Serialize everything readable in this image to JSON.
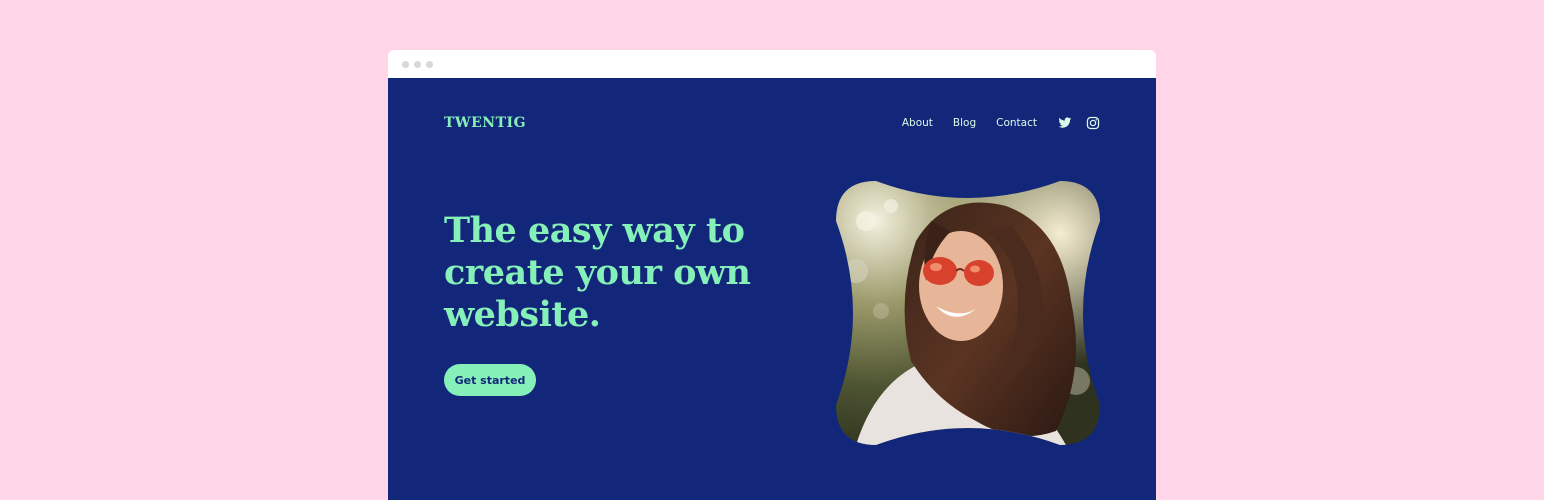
{
  "site": {
    "logo": "TWENTIG",
    "nav": {
      "items": [
        "About",
        "Blog",
        "Contact"
      ],
      "social": [
        "twitter-icon",
        "instagram-icon"
      ]
    },
    "hero": {
      "headline": "The easy way to create your own website.",
      "cta_label": "Get started",
      "image": "photo of smiling woman with sunglasses and long wavy hair"
    }
  },
  "colors": {
    "page_background": "#ffd6e8",
    "site_background": "#13277a",
    "accent": "#86f0b9",
    "nav_text": "#d8fbe9"
  }
}
